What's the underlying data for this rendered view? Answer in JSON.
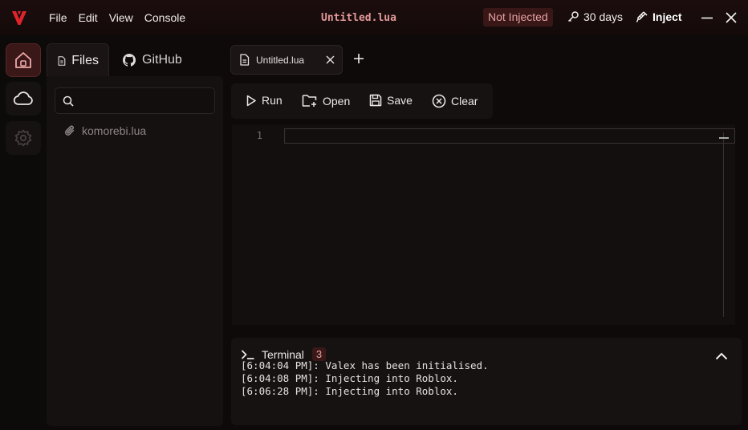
{
  "menu": {
    "items": [
      "File",
      "Edit",
      "View",
      "Console"
    ]
  },
  "titlebar": {
    "file_title": "Untitled.lua",
    "status_badge": "Not Injected",
    "license_days": "30 days",
    "inject_label": "Inject"
  },
  "rail": {
    "items": [
      "home-icon",
      "cloud-icon",
      "gear-icon"
    ]
  },
  "explorer": {
    "tabs": [
      {
        "label": "Files",
        "icon": "file-icon"
      },
      {
        "label": "GitHub",
        "icon": "github-icon"
      }
    ],
    "search": {
      "value": "",
      "placeholder": ""
    },
    "files": [
      "komorebi.lua"
    ]
  },
  "editor": {
    "tabs": [
      {
        "label": "Untitled.lua"
      }
    ],
    "line_numbers": [
      "1"
    ],
    "content": ""
  },
  "toolbar": {
    "run_label": "Run",
    "open_label": "Open",
    "save_label": "Save",
    "clear_label": "Clear"
  },
  "terminal": {
    "title": "Terminal",
    "count": "3",
    "lines": [
      "[6:04:04 PM]: Valex has been initialised.",
      "[6:04:08 PM]: Injecting into Roblox.",
      "[6:06:28 PM]: Injecting into Roblox."
    ]
  },
  "colors": {
    "accent": "#e3a2a2",
    "badge_bg": "#3a1717",
    "background": "#0e0a0a",
    "logo": "#e0242c"
  }
}
